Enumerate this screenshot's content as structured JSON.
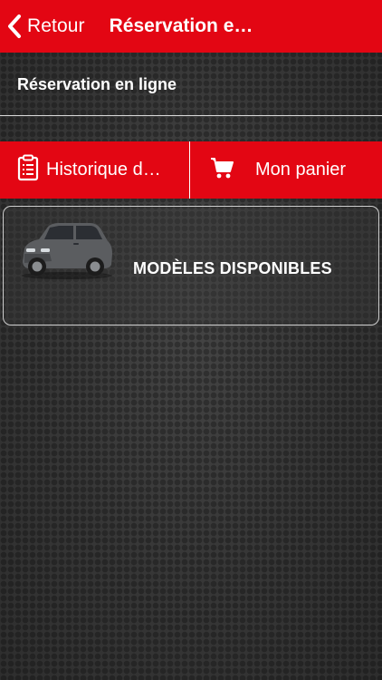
{
  "navbar": {
    "back_icon": "chevron-left-icon",
    "back_label": "Retour",
    "title": "Réservation e…"
  },
  "section": {
    "title": "Réservation en ligne"
  },
  "actions": {
    "history": {
      "icon": "clipboard-icon",
      "label": "Historique d…"
    },
    "cart": {
      "icon": "shopping-cart-icon",
      "label": "Mon panier"
    }
  },
  "models_card": {
    "image": "car-image",
    "label": "MODÈLES DISPONIBLES"
  },
  "colors": {
    "accent": "#e30613",
    "background": "#3a3a3a",
    "text": "#ffffff"
  }
}
